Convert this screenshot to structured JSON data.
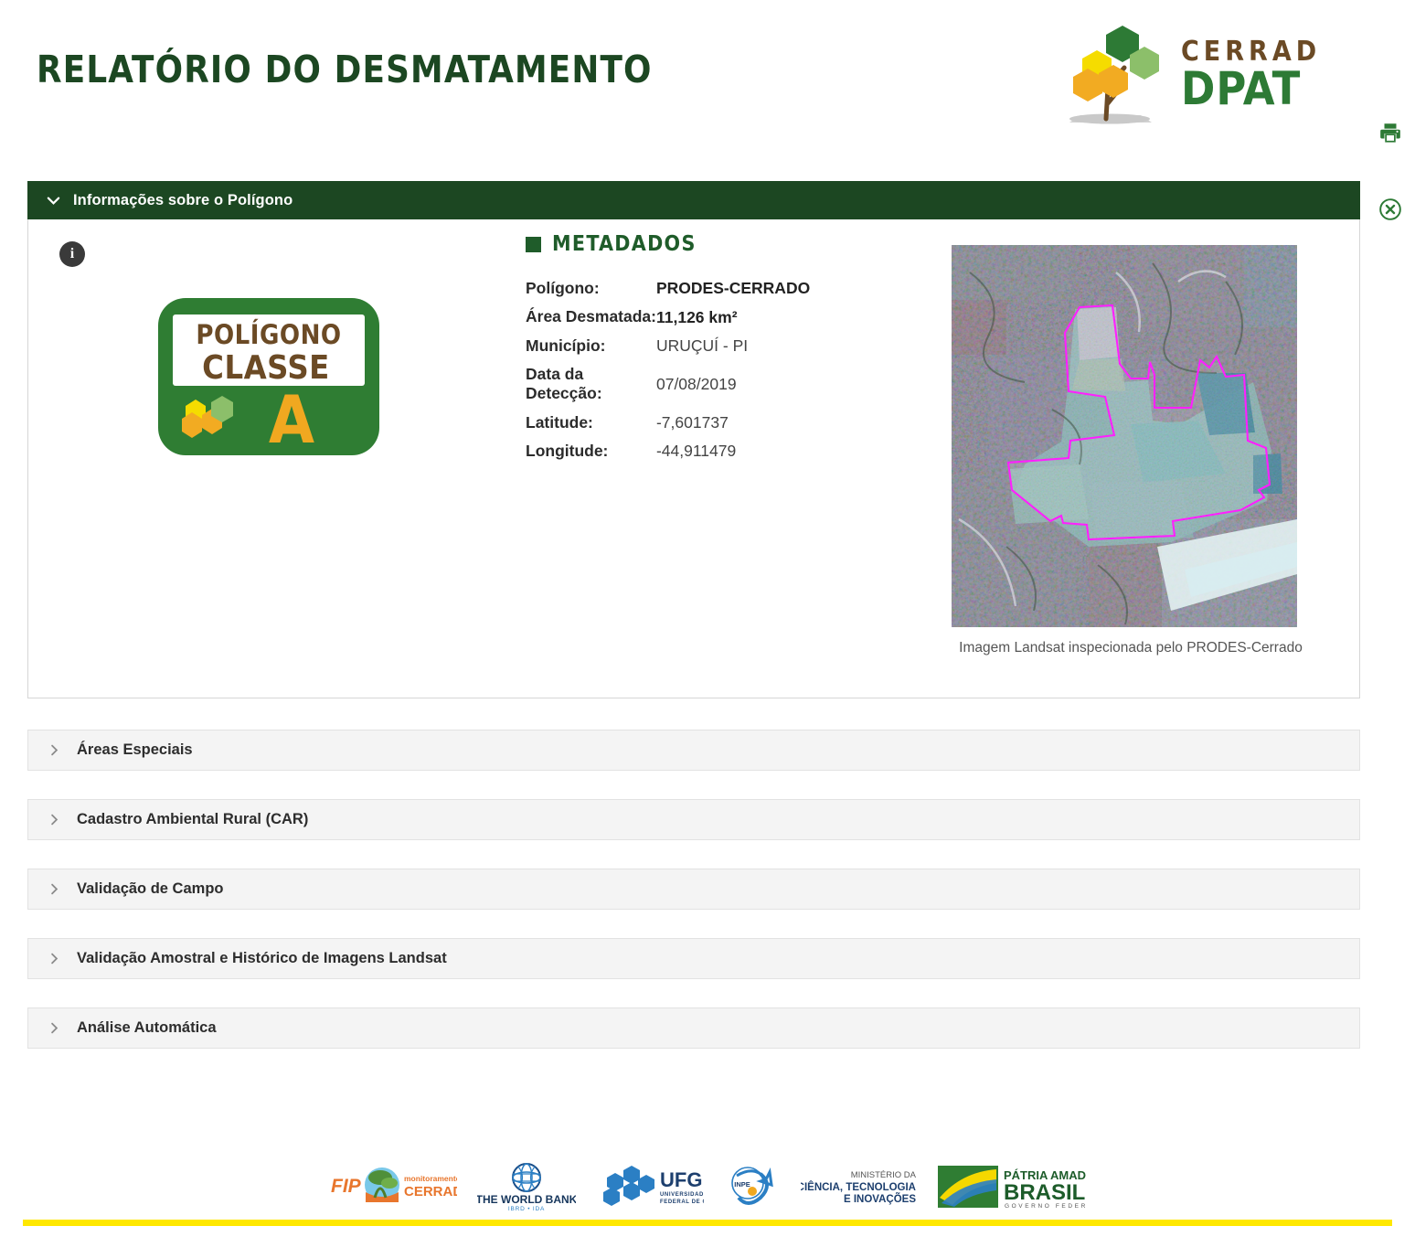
{
  "header": {
    "title": "RELATÓRIO DO DESMATAMENTO",
    "logo": {
      "word_top": "CERRADO",
      "word_bottom": "DPAT",
      "brand_brown": "#6b4a25",
      "brand_green": "#2d7a35"
    },
    "actions": [
      {
        "name": "print-button",
        "icon": "printer-icon",
        "color": "#2d7a35"
      },
      {
        "name": "close-button",
        "icon": "close-circle-icon",
        "color": "#2d7a35"
      }
    ]
  },
  "panel": {
    "open_section": {
      "label": "Informações sobre o Polígono",
      "icon": "chevron-down-icon",
      "bg": "#1c4722"
    },
    "info_icon_glyph": "i",
    "badge": {
      "line1": "POLÍGONO",
      "line2": "CLASSE",
      "letter": "A",
      "border_green": "#2f7d33",
      "text_brown": "#6b4a25",
      "letter_color": "#f0a820"
    },
    "metadata": {
      "heading": "METADADOS",
      "rows": [
        {
          "key": "Polígono:",
          "value": "PRODES-CERRADO",
          "bold": true
        },
        {
          "key": "Área Desmatada:",
          "value": "11,126 km²",
          "bold": true
        },
        {
          "key": "Município:",
          "value": "URUÇUÍ - PI",
          "bold": false
        },
        {
          "key": "Data da\nDetecção:",
          "value": "07/08/2019",
          "bold": false
        },
        {
          "key": "Latitude:",
          "value": "-7,601737",
          "bold": false
        },
        {
          "key": "Longitude:",
          "value": "-44,911479",
          "bold": false
        }
      ]
    },
    "image": {
      "caption": "Imagem Landsat inspecionada pelo PRODES-Cerrado",
      "polygon_outline_color": "#ff00ff",
      "alt_name": "landsat-satellite-image"
    }
  },
  "collapsed_sections": [
    {
      "label": "Áreas Especiais",
      "icon": "chevron-right-icon"
    },
    {
      "label": "Cadastro Ambiental Rural (CAR)",
      "icon": "chevron-right-icon"
    },
    {
      "label": "Validação de Campo",
      "icon": "chevron-right-icon"
    },
    {
      "label": "Validação Amostral e Histórico de Imagens Landsat",
      "icon": "chevron-right-icon"
    },
    {
      "label": "Análise Automática",
      "icon": "chevron-right-icon"
    }
  ],
  "footer": {
    "logos": [
      {
        "name": "fip-cerrado-logo",
        "text_a": "FIP",
        "text_b": "monitoramento",
        "text_c": "CERRADO"
      },
      {
        "name": "world-bank-logo",
        "text_a": "THE WORLD BANK",
        "text_b": "IBRD • IDA"
      },
      {
        "name": "ufg-logo",
        "text_a": "UFG",
        "text_b": "UNIVERSIDADE",
        "text_c": "FEDERAL DE GOIÁS"
      },
      {
        "name": "inpe-logo",
        "text_a": "INPE"
      },
      {
        "name": "ministry-logo",
        "text_a": "MINISTÉRIO DA",
        "text_b": "CIÊNCIA, TECNOLOGIA",
        "text_c": "E INOVAÇÕES"
      },
      {
        "name": "brasil-governo-federal-logo",
        "text_a": "PÁTRIA AMADA",
        "text_b": "BRASIL",
        "text_c": "GOVERNO FEDERAL"
      }
    ],
    "accent_bar_color": "#ffe800"
  }
}
